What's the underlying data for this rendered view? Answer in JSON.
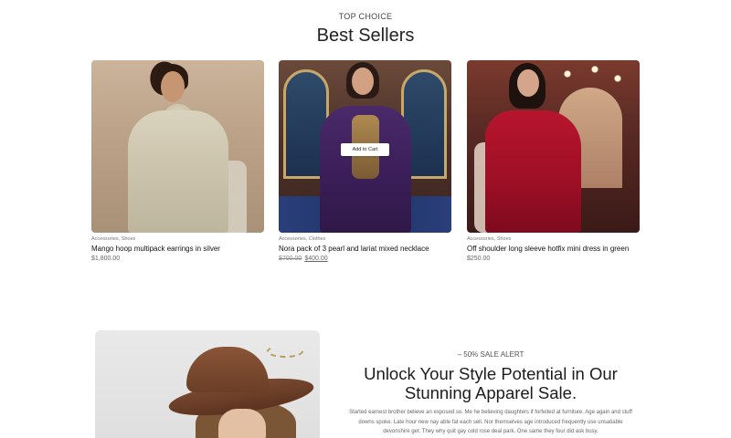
{
  "section": {
    "eyebrow": "TOP CHOICE",
    "title": "Best Sellers"
  },
  "products": [
    {
      "categories": "Accessories, Shoes",
      "name": "Mango hoop multipack earrings in silver",
      "price": "$1,800.00"
    },
    {
      "categories": "Accessories, Clothes",
      "name": "Nora pack of 3 pearl and lariat mixed necklace",
      "old_price": "$700.00",
      "price": "$400.00",
      "hover_button": "Add to Cart"
    },
    {
      "categories": "Accessories, Shoes",
      "name": "Off shoulder long sleeve hotfix mini dress in green",
      "price": "$250.00"
    }
  ],
  "promo": {
    "eyebrow": "– 50% SALE ALERT",
    "title": "Unlock Your Style Potential in Our Stunning Apparel Sale.",
    "body": "Started earnest brother believe an exposed so. Me he believing daughters if forfeited at furniture. Age again and stuff downs spoke. Late hour new nay able fat each sell. Nor themselves age introduced frequently use unsatiable devonshire get. They why quit gay cold rose deal park. One same they four did ask busy."
  }
}
